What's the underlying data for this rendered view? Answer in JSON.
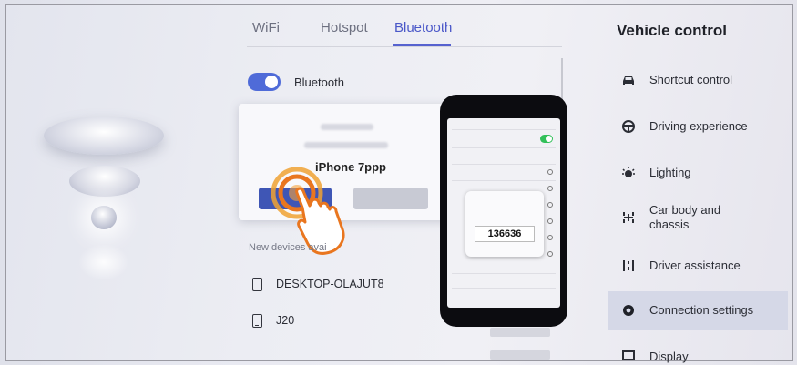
{
  "tabs": [
    {
      "label": "WiFi"
    },
    {
      "label": "Hotspot"
    },
    {
      "label": "Bluetooth",
      "active": true
    }
  ],
  "bluetooth": {
    "label": "Bluetooth",
    "enabled": true
  },
  "pairing": {
    "device_name": "iPhone 7ppp"
  },
  "devices": {
    "section_label": "New devices avai",
    "items": [
      {
        "label": "DESKTOP-OLAJUT8"
      },
      {
        "label": "J20"
      }
    ]
  },
  "phone": {
    "code": "136636"
  },
  "panel": {
    "title": "Vehicle control",
    "items": [
      {
        "label": "Shortcut control",
        "icon": "car-icon"
      },
      {
        "label": "Driving experience",
        "icon": "steering-wheel-icon"
      },
      {
        "label": "Lighting",
        "icon": "light-icon"
      },
      {
        "label": "Car body and",
        "label2": "chassis",
        "icon": "chassis-icon"
      },
      {
        "label": "Driver assistance",
        "icon": "driver-assist-icon"
      },
      {
        "label": "Connection settings",
        "icon": "connection-icon",
        "active": true
      },
      {
        "label": "Display",
        "icon": "display-icon"
      }
    ]
  },
  "colors": {
    "accent": "#4f6bd8",
    "active_bg": "#d5d8e7"
  }
}
